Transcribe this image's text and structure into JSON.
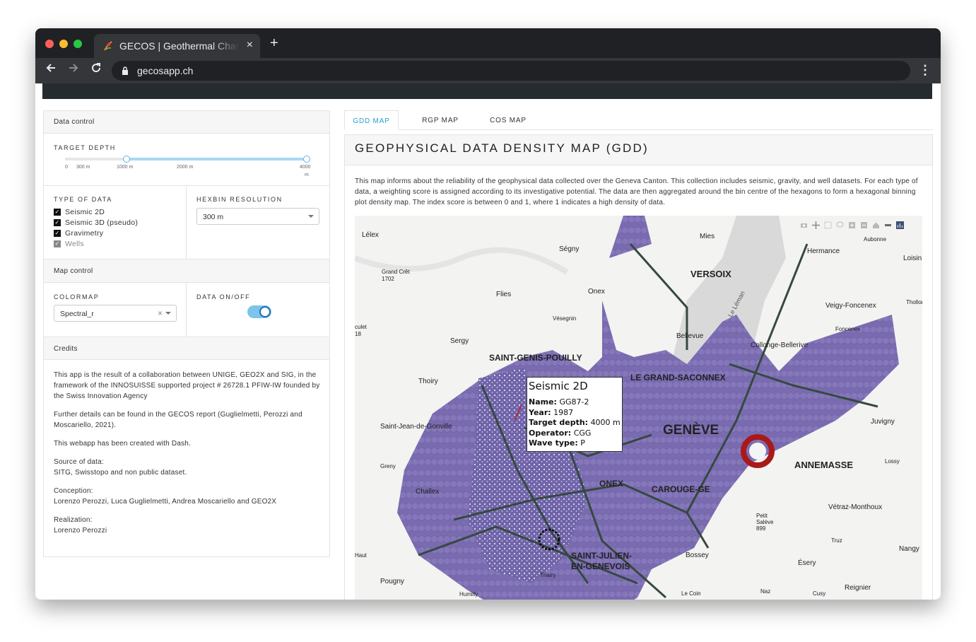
{
  "browser": {
    "tab_title": "GECOS | Geothermal Chance",
    "url": "gecosapp.ch",
    "new_tab": "+",
    "close_tab": "×",
    "menu": "⋮"
  },
  "sidebar": {
    "data_control": "Data control",
    "target_depth": {
      "label": "TARGET DEPTH",
      "ticks": [
        "0",
        "300 m",
        "1000 m",
        "2000 m",
        "4000",
        "m"
      ],
      "range": [
        1000,
        4000
      ]
    },
    "type_of_data": {
      "label": "TYPE OF DATA",
      "items": [
        {
          "label": "Seismic 2D",
          "checked": true
        },
        {
          "label": "Seismic 3D (pseudo)",
          "checked": true
        },
        {
          "label": "Gravimetry",
          "checked": true
        },
        {
          "label": "Wells",
          "checked": true
        }
      ]
    },
    "hexbin": {
      "label": "HEXBIN RESOLUTION",
      "value": "300 m"
    },
    "map_control": "Map control",
    "colormap": {
      "label": "COLORMAP",
      "value": "Spectral_r",
      "clear": "×"
    },
    "data_onoff": {
      "label": "DATA ON/OFF",
      "on": true
    },
    "credits_title": "Credits",
    "credits": {
      "p1": "This app is the result of a collaboration between UNIGE, GEO2X and SIG, in the framework of the INNOSUISSE supported project # 26728.1 PFIW-IW founded by the Swiss Innovation Agency",
      "p2": "Further details can be found in the GECOS report (Guglielmetti, Perozzi and Moscariello, 2021).",
      "p3": "This webapp has been created with Dash.",
      "source_label": "Source of data:",
      "source_value": "SITG, Swisstopo and non public dataset.",
      "conception_label": "Conception:",
      "conception_value": "Lorenzo Perozzi, Luca Guglielmetti, Andrea Moscariello and GEO2X",
      "realization_label": "Realization:",
      "realization_value": "Lorenzo Perozzi"
    }
  },
  "main": {
    "tabs": [
      "GDD MAP",
      "RGP MAP",
      "COS MAP"
    ],
    "active_tab": 0,
    "title": "GEOPHYSICAL DATA DENSITY MAP (GDD)",
    "description": "This map informs about the reliability of the geophysical data collected over the Geneva Canton. This collection includes seismic, gravity, and well datasets. For each type of data, a weighting score is assigned according to its investigative potential. The data are then aggregated around the bin centre of the hexagons to form a hexagonal binning plot density map. The index score is between 0 and 1, where 1 indicates a high density of data."
  },
  "map": {
    "places": [
      "Lélex",
      "Ségny",
      "Mies",
      "Aubonne",
      "Hermance",
      "Loisin",
      "Grand Crêt 1702",
      "Flies",
      "Onex",
      "VERSOIX",
      "Vésegnin",
      "Veigy-Foncenex",
      "Thollon",
      "Foncenex",
      "culet 18",
      "Sergy",
      "Bellevue",
      "Collonge-Bellerive",
      "SAINT-GENIS-POUILLY",
      "LE GRAND-SACONNEX",
      "Thoiry",
      "GENÈVE",
      "Juvigny",
      "Saint-Jean-de-Gonville",
      "ANNEMASSE",
      "Lossy",
      "Greny",
      "Challex",
      "ONEX",
      "CAROUGE-GE",
      "Vétraz-Monthoux",
      "Petit Salève 899",
      "Truz",
      "Haut",
      "SAINT-JULIEN-EN-GENEVOIS",
      "Bossey",
      "Nangy",
      "Ésery",
      "Pougny",
      "Thairy",
      "Le Coin",
      "Naz",
      "Cusy",
      "Reignier",
      "Humilly",
      "Le Léman"
    ],
    "tooltip": {
      "title": "Seismic 2D",
      "rows": [
        {
          "label": "Name:",
          "value": "GG87-2"
        },
        {
          "label": "Year:",
          "value": "1987"
        },
        {
          "label": "Target depth:",
          "value": "4000 m"
        },
        {
          "label": "Operator:",
          "value": "CGG"
        },
        {
          "label": "Wave type:",
          "value": "P"
        }
      ]
    }
  },
  "colors": {
    "accent": "#2a9fd6",
    "hexbin": "#7e6fb5",
    "faults": "#35493f",
    "well": "#b51c1c"
  }
}
